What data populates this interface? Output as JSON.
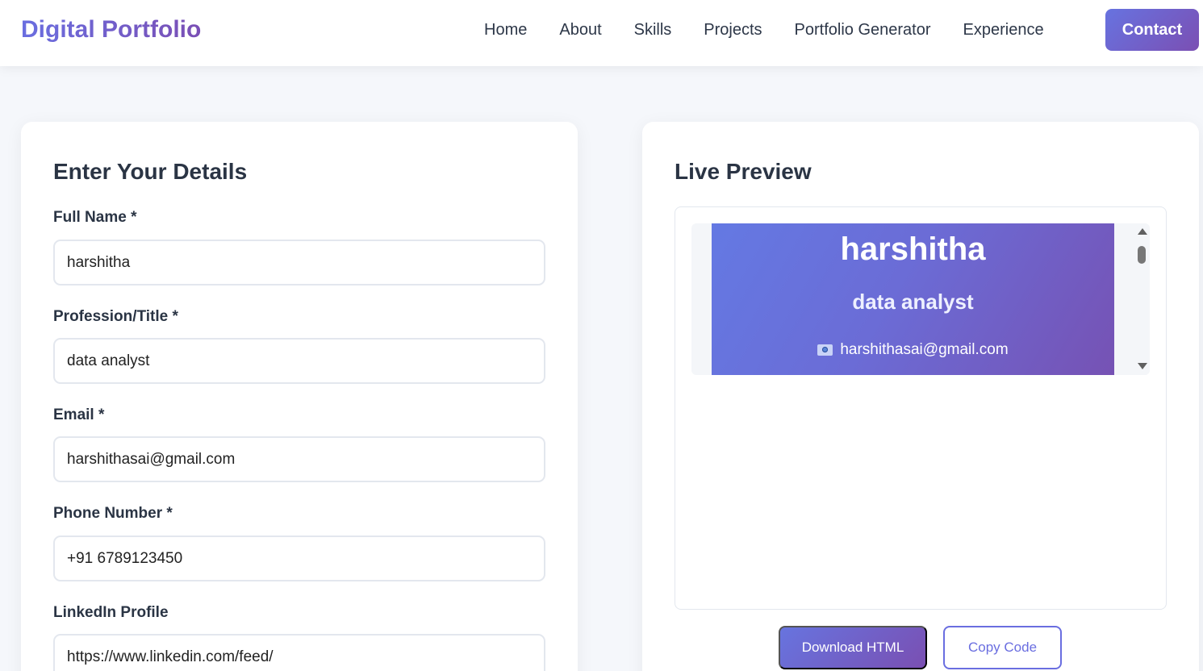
{
  "nav": {
    "brand": "Digital Portfolio",
    "links": [
      "Home",
      "About",
      "Skills",
      "Projects",
      "Portfolio Generator",
      "Experience"
    ],
    "contact_label": "Contact"
  },
  "form": {
    "title": "Enter Your Details",
    "fields": [
      {
        "label": "Full Name *",
        "value": "harshitha"
      },
      {
        "label": "Profession/Title *",
        "value": "data analyst"
      },
      {
        "label": "Email *",
        "value": "harshithasai@gmail.com"
      },
      {
        "label": "Phone Number *",
        "value": "+91 6789123450"
      },
      {
        "label": "LinkedIn Profile",
        "value": "https://www.linkedin.com/feed/"
      }
    ]
  },
  "preview": {
    "title": "Live Preview",
    "name": "harshitha",
    "profession": "data analyst",
    "email": "harshithasai@gmail.com",
    "email_icon": "email-icon",
    "download_label": "Download HTML",
    "copy_label": "Copy Code"
  },
  "colors": {
    "accent_start": "#6774df",
    "accent_end": "#7a4fb2",
    "page_bg": "#f5f7fb"
  }
}
